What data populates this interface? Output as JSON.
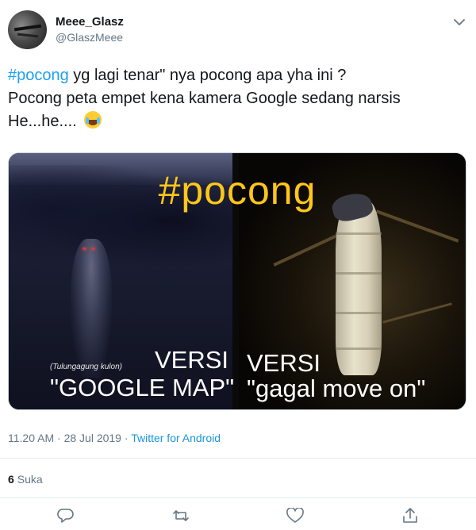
{
  "user": {
    "name": "Meee_Glasz",
    "handle": "@GlaszMeee"
  },
  "tweet": {
    "hashtag": "#pocong",
    "line1_rest": " yg lagi tenar\" nya pocong apa yha ini ?",
    "line2": "Pocong peta empet kena kamera Google sedang narsis",
    "line3": "He...he...."
  },
  "media": {
    "hashtag_caption": "#pocong",
    "small_caption": "(Tulungagung kulon)",
    "left_versi": "VERSI",
    "left_label": "\"GOOGLE MAP\"",
    "right_versi": "VERSI",
    "right_label": "\"gagal move on\""
  },
  "meta": {
    "time": "11.20 AM",
    "date": "28 Jul 2019",
    "separator": " · ",
    "app": "Twitter for Android"
  },
  "likes": {
    "count": "6",
    "label": "Suka"
  },
  "icons": {
    "reply": "reply-icon",
    "retweet": "retweet-icon",
    "like": "heart-icon",
    "share": "share-icon",
    "menu": "chevron-down-icon",
    "emoji": "tears-of-joy-emoji"
  },
  "colors": {
    "link": "#1da1f2",
    "meta": "#657786",
    "text": "#14171a",
    "caption_yellow": "#ffc61a"
  }
}
